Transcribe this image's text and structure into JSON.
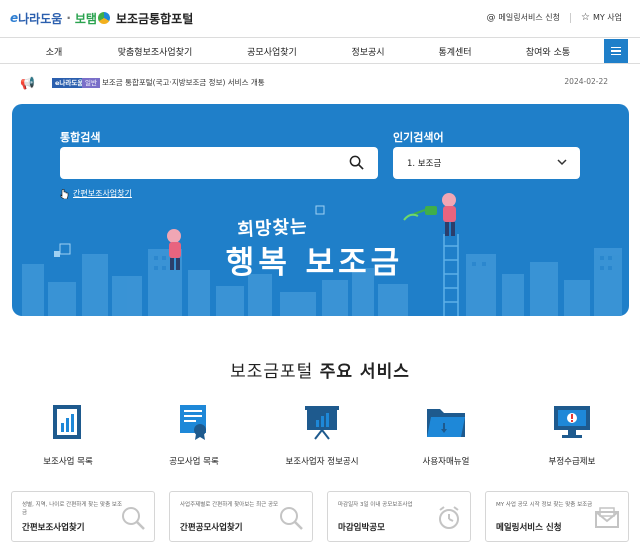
{
  "header": {
    "logo": {
      "e": "e",
      "nara": "나라도움",
      "dot": "·",
      "bo": "보탬",
      "portal": "보조금통합포털"
    },
    "links": [
      {
        "label": "메일링서비스 신청",
        "icon": "at-icon"
      },
      {
        "label": "MY 사업",
        "icon": "star-icon"
      }
    ]
  },
  "nav": {
    "items": [
      "소개",
      "맞춤형보조사업찾기",
      "공모사업찾기",
      "정보공시",
      "통계센터",
      "참여와 소통"
    ],
    "menu_icon": "hamburger-menu-icon"
  },
  "notice": {
    "tag_source": "e나라도움",
    "tag_type": "일반",
    "text": "보조금 통합포털(국고·지방보조금 정보) 서비스 개통",
    "date": "2024-02-22"
  },
  "banner": {
    "search_label": "통합검색",
    "search_value": "",
    "search_placeholder": "",
    "popular_label": "인기검색어",
    "popular_value": "1. 보조금",
    "easy_link": "간편보조사업찾기",
    "headline_small": "희망찾는",
    "headline_big": "행복 보조금",
    "colors": {
      "banner": "#1f7fc9",
      "building": "#3f97d8"
    }
  },
  "services": {
    "title_a": "보조금포털 ",
    "title_b": "주요 서비스",
    "items": [
      {
        "label": "보조사업 목록",
        "icon": "bar-chart-document-icon"
      },
      {
        "label": "공모사업 목록",
        "icon": "certificate-icon"
      },
      {
        "label": "보조사업자 정보공시",
        "icon": "presentation-board-icon"
      },
      {
        "label": "사용자매뉴얼",
        "icon": "folder-icon"
      },
      {
        "label": "부정수급제보",
        "icon": "monitor-alert-icon"
      }
    ]
  },
  "cards": [
    {
      "desc": "성별, 지역, 나이로 간편하게 찾는 맞춤 보조금",
      "title": "간편보조사업찾기",
      "icon": "magnifier-icon"
    },
    {
      "desc": "사업주제별로 간편하게 찾아보는 최근 공모",
      "title": "간편공모사업찾기",
      "icon": "magnifier-icon"
    },
    {
      "desc": "마감일자 3일 이내 공모보조사업",
      "title": "마감임박공모",
      "icon": "alarm-clock-icon"
    },
    {
      "desc": "MY 사업 공모 시작 정보 찾는 맞춤 보조금",
      "title": "메일링서비스 신청",
      "icon": "envelope-icon"
    }
  ]
}
